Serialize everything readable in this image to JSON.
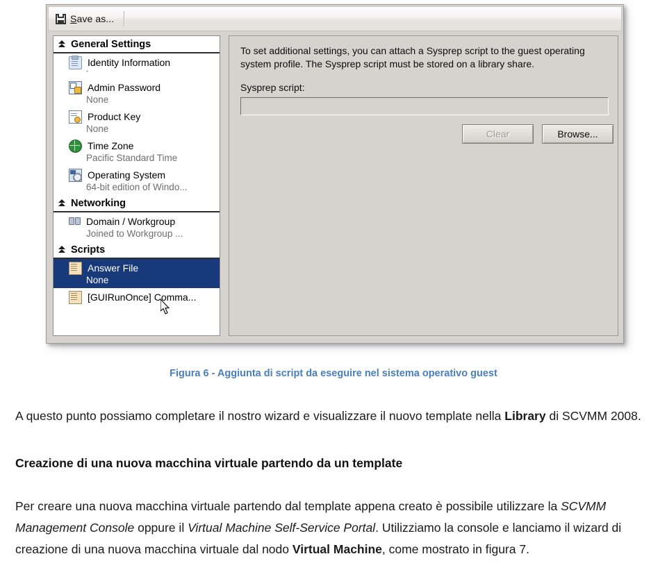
{
  "dialog": {
    "toolbar": {
      "save_as_label": "Save as...",
      "save_as_accesskey": "S",
      "save_as_rest": "ave as...",
      "icon": "floppy-disk-icon"
    },
    "nav": {
      "groups": [
        {
          "title": "General Settings",
          "icon": "chevron-double-up-icon",
          "items": [
            {
              "label": "Identity Information",
              "sub": "*",
              "sub_tiny": true,
              "icon": "clipboard-icon",
              "selected": false
            },
            {
              "label": "Admin Password",
              "sub": "None",
              "icon": "admin-password-icon",
              "selected": false
            },
            {
              "label": "Product Key",
              "sub": "None",
              "icon": "product-key-icon",
              "selected": false
            },
            {
              "label": "Time Zone",
              "sub": "Pacific Standard Time",
              "icon": "globe-icon",
              "selected": false
            },
            {
              "label": "Operating System",
              "sub": "64-bit edition of Windo...",
              "icon": "operating-system-icon",
              "selected": false
            }
          ]
        },
        {
          "title": "Networking",
          "icon": "chevron-double-up-icon",
          "items": [
            {
              "label": "Domain / Workgroup",
              "sub": "Joined to Workgroup ...",
              "icon": "domain-workgroup-icon",
              "selected": false
            }
          ]
        },
        {
          "title": "Scripts",
          "icon": "chevron-double-up-icon",
          "items": [
            {
              "label": "Answer File",
              "sub": "None",
              "icon": "scroll-icon",
              "selected": true
            },
            {
              "label": "[GUIRunOnce] Comma...",
              "sub": "",
              "icon": "scroll-icon",
              "selected": false
            }
          ]
        }
      ]
    },
    "detail": {
      "description": "To set additional settings, you can attach a Sysprep script to the guest operating system profile. The Sysprep script must be stored on a library share.",
      "script_label": "Sysprep script:",
      "script_value": "",
      "script_placeholder": "",
      "clear_button": "Clear",
      "browse_button": "Browse...",
      "clear_disabled": true
    },
    "colors": {
      "selection_navy": "#183a7a",
      "chrome_grey": "#d6d3ce"
    }
  },
  "document": {
    "caption": "Figura 6 - Aggiunta di script da eseguire nel sistema operativo guest",
    "caption_color": "#4a7ebb",
    "paragraph_intro": {
      "part1": "A questo punto possiamo completare il nostro wizard e visualizzare il nuovo template nella ",
      "bold1": "Library",
      "part2": " di SCVMM 2008."
    },
    "heading": "Creazione di una nuova macchina virtuale partendo da un template",
    "paragraph_body": {
      "part1": "Per creare una nuova macchina virtuale partendo dal template appena creato è possibile utilizzare la ",
      "italic1": "SCVMM Management Console",
      "part2": " oppure il ",
      "italic2": "Virtual Machine Self-Service Portal",
      "part3": ". Utilizziamo la console e lanciamo il wizard di creazione di una nuova macchina virtuale dal nodo ",
      "bold1": "Virtual Machine",
      "part4": ", come mostrato in figura 7."
    }
  }
}
